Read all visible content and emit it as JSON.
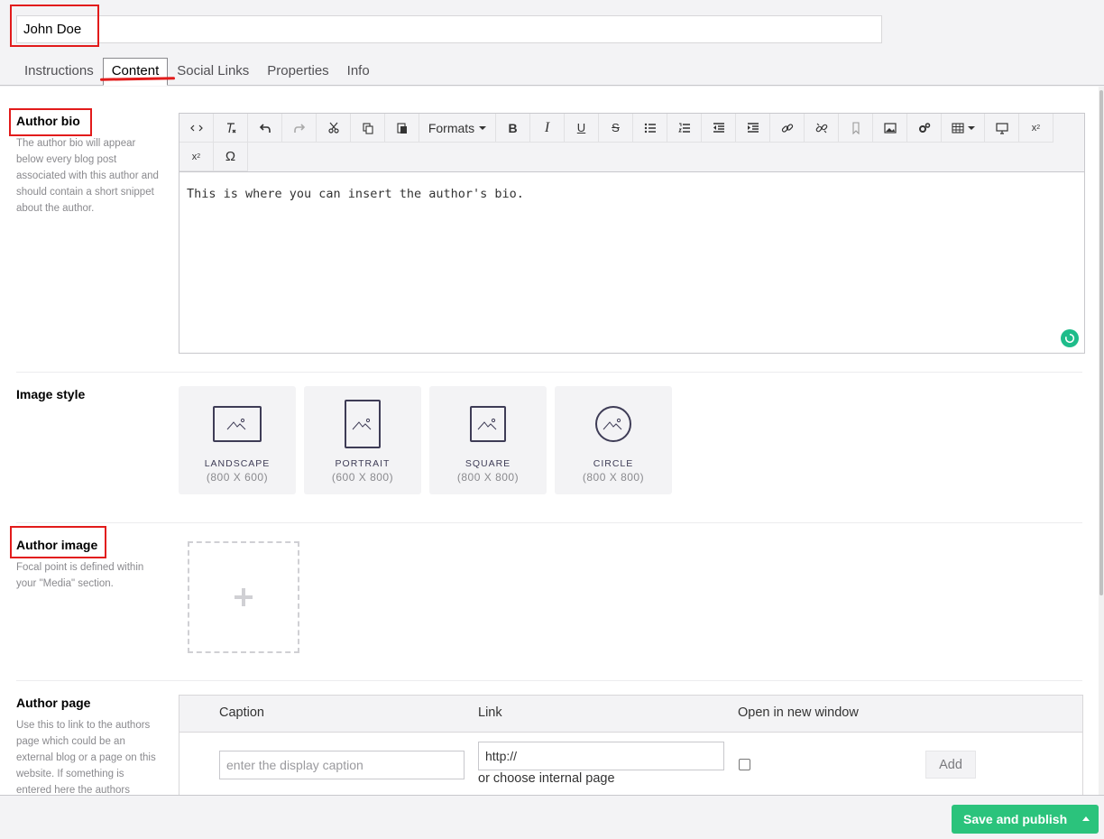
{
  "header": {
    "name_value": "John Doe",
    "tabs": [
      {
        "label": "Instructions"
      },
      {
        "label": "Content",
        "active": true
      },
      {
        "label": "Social Links"
      },
      {
        "label": "Properties"
      },
      {
        "label": "Info"
      }
    ]
  },
  "author_bio": {
    "label": "Author bio",
    "description": "The author bio will appear below every blog post associated with this author and should contain a short snippet about the author.",
    "editor": {
      "formats_label": "Formats",
      "toolbar_icons": [
        "code-icon",
        "clear-format-icon",
        "undo-icon",
        "redo-icon",
        "cut-icon",
        "copy-icon",
        "paste-icon",
        "formats-dropdown",
        "bold-icon",
        "italic-icon",
        "underline-icon",
        "strikethrough-icon",
        "bullet-list-icon",
        "numbered-list-icon",
        "outdent-icon",
        "indent-icon",
        "link-icon",
        "unlink-icon",
        "anchor-icon",
        "image-icon",
        "macro-icon",
        "table-icon",
        "embed-icon",
        "subscript-icon",
        "superscript-icon",
        "omega-icon"
      ],
      "content": "This is where you can insert the author's bio."
    }
  },
  "image_style": {
    "label": "Image style",
    "options": [
      {
        "name": "LANDSCAPE",
        "size": "(800 X 600)"
      },
      {
        "name": "PORTRAIT",
        "size": "(600 X 800)"
      },
      {
        "name": "SQUARE",
        "size": "(800 X 800)"
      },
      {
        "name": "CIRCLE",
        "size": "(800 X 800)"
      }
    ]
  },
  "author_image": {
    "label": "Author image",
    "description": "Focal point is defined within your \"Media\" section."
  },
  "author_page": {
    "label": "Author page",
    "description": "Use this to link to the authors page which could be an external blog or a page on this website. If something is entered here the authors",
    "table": {
      "col_caption": "Caption",
      "col_link": "Link",
      "col_new_window": "Open in new window",
      "caption_placeholder": "enter the display caption",
      "link_value": "http://",
      "internal_link_label": "or choose internal page",
      "add_label": "Add"
    }
  },
  "footer": {
    "save_label": "Save and publish"
  },
  "colors": {
    "highlight": "#e21b1b",
    "publish_green": "#2bc37c",
    "spinner_green": "#1ebc8a"
  }
}
